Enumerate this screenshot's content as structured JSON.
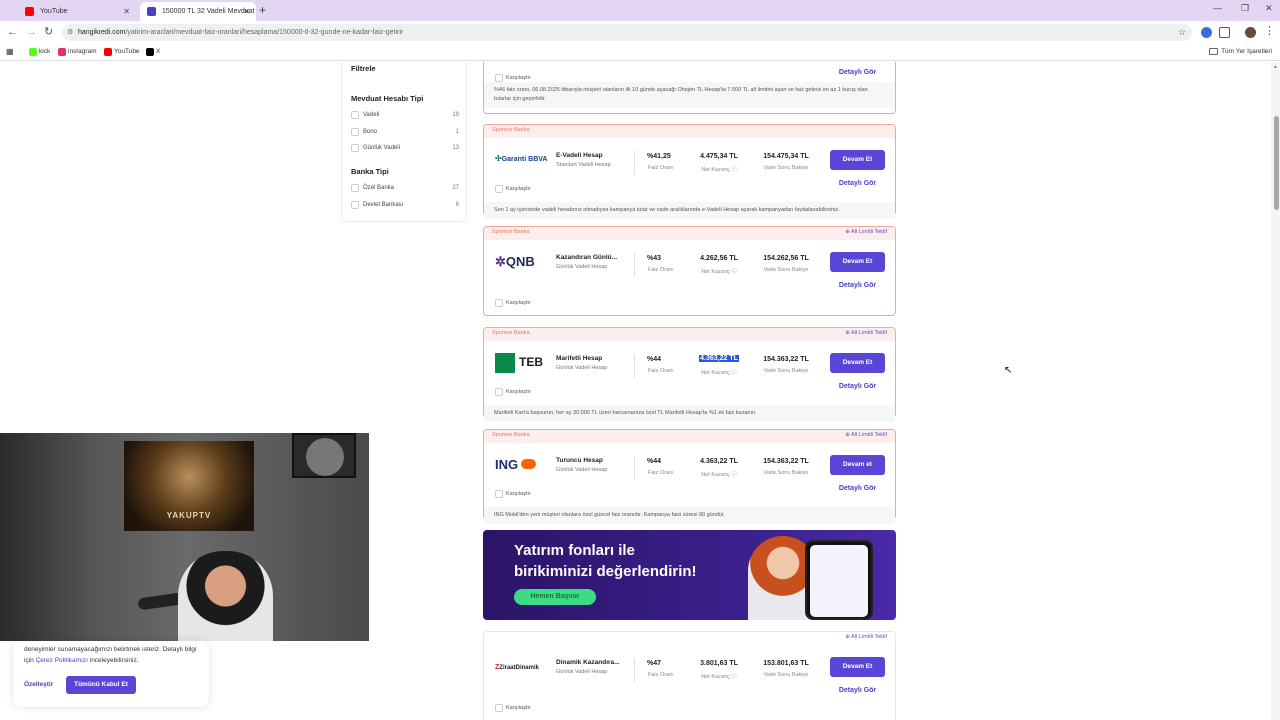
{
  "browser": {
    "tabs": [
      {
        "title": "YouTube",
        "icon": "youtube-icon",
        "color": "#ff0000"
      },
      {
        "title": "150000 TL 32 Vadeli Mevduat",
        "icon": "site-icon",
        "color": "#4a3ec8"
      }
    ],
    "url_host": "hangikredi.com",
    "url_path": "/yatirim-araclari/mevduat-faiz-oranlari/hesaplama/150000-tl-32-gunde-ne-kadar-faiz-getirir",
    "bookmarks": [
      {
        "label": "kick",
        "icon": "kick-icon",
        "color": "#53fc18"
      },
      {
        "label": "instagram",
        "icon": "instagram-icon",
        "color": "#e1306c"
      },
      {
        "label": "YouTube",
        "icon": "youtube-icon",
        "color": "#ff0000"
      },
      {
        "label": "X",
        "icon": "x-icon",
        "color": "#000000"
      }
    ],
    "all_bookmarks": "Tüm Yer İşaretleri"
  },
  "sidebar": {
    "title": "Filtrele",
    "section1": "Mevduat Hesabı Tipi",
    "types": [
      {
        "label": "Vadeli",
        "count": "19"
      },
      {
        "label": "Bono",
        "count": "1"
      },
      {
        "label": "Günlük Vadeli",
        "count": "13"
      }
    ],
    "section2": "Banka Tipi",
    "banks": [
      {
        "label": "Özel Bankа",
        "count": "27"
      },
      {
        "label": "Devlet Bankası",
        "count": "6"
      }
    ]
  },
  "top_card": {
    "compare": "Karşılaştır",
    "detail": "Detaylı Gör",
    "note": "%46 faiz oranı, 06.08.2025 itibarıyla müşteri olanların ilk 10 günde açacağı Ohojen TL Hesap'ta 7.500 TL alt limitini aşan ve faiz getirisi en az 1 kuruş olan tutarlar için geçerlidir."
  },
  "offers": [
    {
      "sponsor": "Sponsor Banka",
      "limit": "",
      "bank": "Garanti BBVA",
      "name": "E-Vadeli Hesap",
      "type": "Standart Vadeli Hesap",
      "rate": "%41,25",
      "rate_label": "Faiz Oranı",
      "gain": "4.475,34 TL",
      "gain_label": "Net Kazanç ⓘ",
      "balance": "154.475,34 TL",
      "balance_label": "Vade Sonu Bakiye",
      "cta": "Devam Et",
      "detail": "Detaylı Gör",
      "compare": "Karşılaştır",
      "note": "Son 1 ay içerisinde vadeli hesabınız olmadıysa kampanya tutar ve vade aralıklarında e-Vadeli Hesap açarak kampanyadan faydalanabilirsiniz."
    },
    {
      "sponsor": "Sponsor Banka",
      "limit": "⊕ Alt Limitli Teklif",
      "bank": "QNB",
      "name": "Kazandıran Günlü...",
      "type": "Günlük Vadeli Hesap",
      "rate": "%43",
      "rate_label": "Faiz Oranı",
      "gain": "4.262,56 TL",
      "gain_label": "Net Kazanç ⓘ",
      "balance": "154.262,56 TL",
      "balance_label": "Vade Sonu Bakiye",
      "cta": "Devam Et",
      "detail": "Detaylı Gör",
      "compare": "Karşılaştır",
      "note": ""
    },
    {
      "sponsor": "Sponsor Banka",
      "limit": "⊕ Alt Limitli Teklif",
      "bank": "TEB",
      "name": "Marifetli Hesap",
      "type": "Günlük Vadeli Hesap",
      "rate": "%44",
      "rate_label": "Faiz Oranı",
      "gain": "4.363,22 TL",
      "gain_label": "Net Kazanç ⓘ",
      "balance": "154.363,22 TL",
      "balance_label": "Vade Sonu Bakiye",
      "cta": "Devam Et",
      "detail": "Detaylı Gör",
      "compare": "Karşılaştır",
      "note": "Marifetli Kart'a başvurun, her ay 30.000 TL üzeri harcamanıza özel TL Marifetli Hesap'ta %1 ek faiz kazanın."
    },
    {
      "sponsor": "Sponsor Banka",
      "limit": "⊕ Alt Limitli Teklif",
      "bank": "ING",
      "name": "Turuncu Hesap",
      "type": "Günlük Vadeli Hesap",
      "rate": "%44",
      "rate_label": "Faiz Oranı",
      "gain": "4.363,22 TL",
      "gain_label": "Net Kazanç ⓘ",
      "balance": "154.363,22 TL",
      "balance_label": "Vade Sonu Bakiye",
      "cta": "Devam et",
      "detail": "Detaylı Gör",
      "compare": "Karşılaştır",
      "note": "ING Mobil'den yeni müşteri olanlara özel güncel faiz oranıdır. Kampanya faizi süresi 90 gündür."
    },
    {
      "sponsor": "",
      "limit": "⊕ Alt Limitli Teklif",
      "bank": "ZiraatDinamik",
      "name": "Dinamik Kazandıra...",
      "type": "Günlük Vadeli Hesap",
      "rate": "%47",
      "rate_label": "Faiz Oranı",
      "gain": "3.801,63 TL",
      "gain_label": "Net Kazanç ⓘ",
      "balance": "153.801,63 TL",
      "balance_label": "Vade Sonu Bakiye",
      "cta": "Devam Et",
      "detail": "Detaylı Gör",
      "compare": "Karşılaştır",
      "note": ""
    }
  ],
  "banner": {
    "line1": "Yatırım fonları ile",
    "line2": "birikiminizi değerlendirin!",
    "cta": "Hemen Başvur"
  },
  "webcam": {
    "poster_text": "YAKUPTV"
  },
  "cookie": {
    "text_before": "deneyimler sunamayacağımızı belirtmek isteriz. Detaylı bilgi için ",
    "link": "Çerez Politikamızı",
    "text_after": " inceleyebilirsiniz.",
    "customize": "Özelleştir",
    "accept": "Tümünü Kabul Et"
  },
  "colors": {
    "accent": "#5a46d6",
    "sponsor": "#e27565",
    "card_border": "#f0a79c"
  }
}
